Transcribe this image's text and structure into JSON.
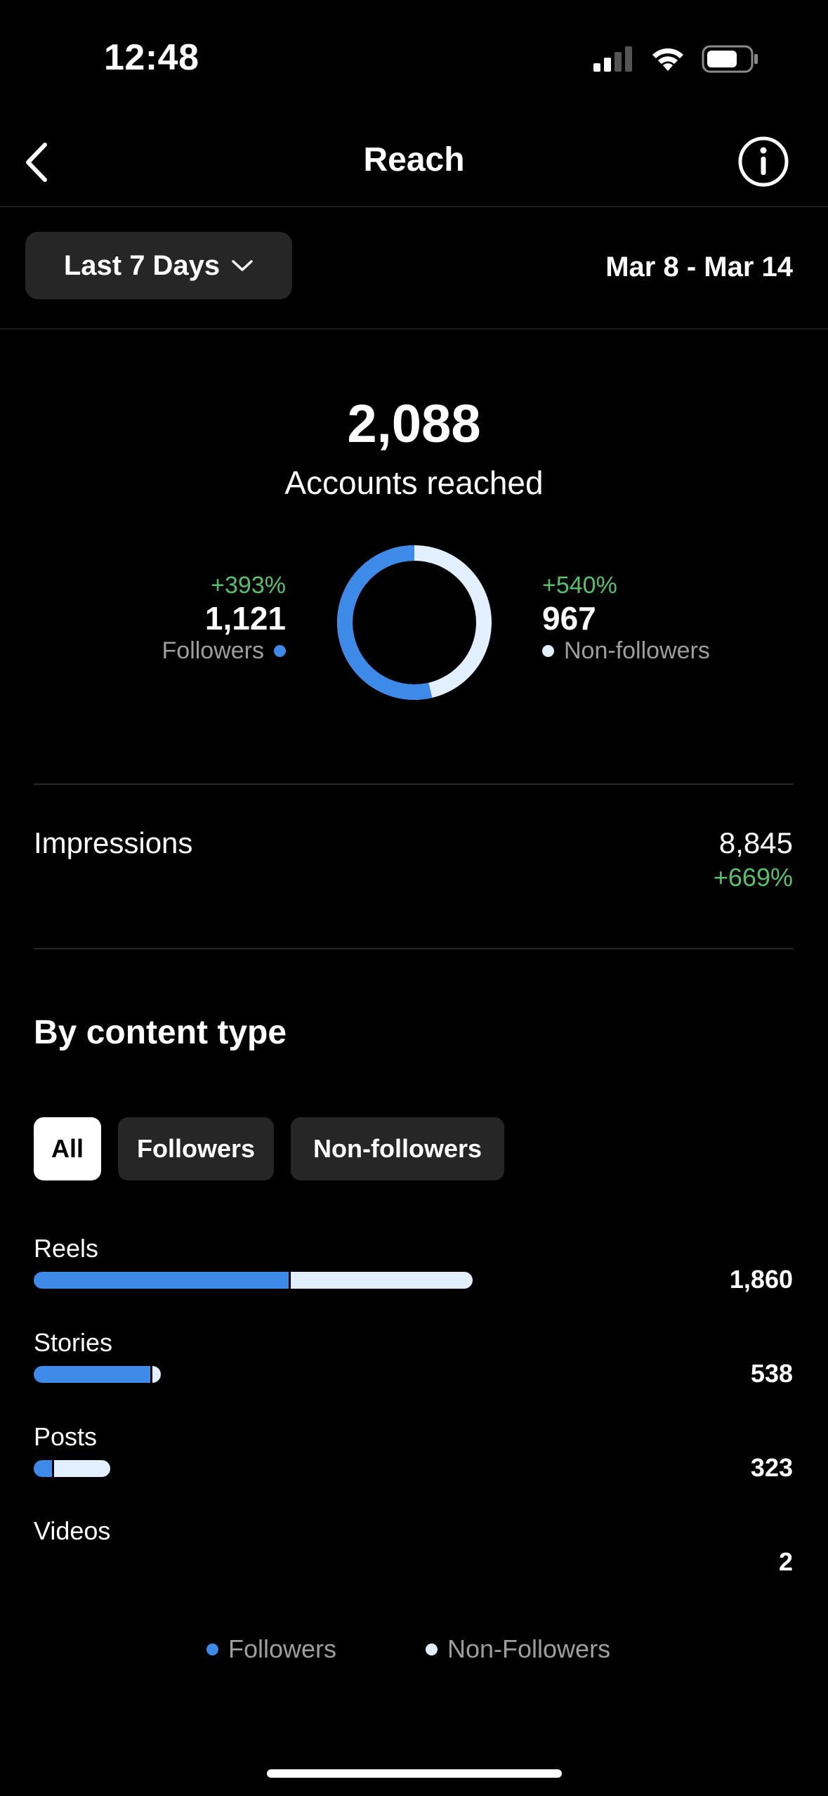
{
  "status_bar": {
    "time": "12:48"
  },
  "nav": {
    "title": "Reach"
  },
  "filter": {
    "range_label": "Last 7 Days",
    "date_range": "Mar 8 - Mar 14"
  },
  "summary": {
    "total": "2,088",
    "total_label": "Accounts reached",
    "followers": {
      "pct": "+393%",
      "value": "1,121",
      "label": "Followers",
      "share": 0.537
    },
    "non_followers": {
      "pct": "+540%",
      "value": "967",
      "label": "Non-followers",
      "share": 0.463
    }
  },
  "impressions": {
    "label": "Impressions",
    "value": "8,845",
    "pct": "+669%"
  },
  "content_type": {
    "title": "By content type",
    "tabs": [
      {
        "label": "All",
        "active": true
      },
      {
        "label": "Followers",
        "active": false
      },
      {
        "label": "Non-followers",
        "active": false
      }
    ],
    "rows": [
      {
        "label": "Reels",
        "value": "1,860",
        "total": 1860,
        "follower_fraction": 0.58
      },
      {
        "label": "Stories",
        "value": "538",
        "total": 538,
        "follower_fraction": 0.92
      },
      {
        "label": "Posts",
        "value": "323",
        "total": 323,
        "follower_fraction": 0.24
      },
      {
        "label": "Videos",
        "value": "2",
        "total": 2,
        "follower_fraction": 0.5
      }
    ],
    "legend": {
      "followers": "Followers",
      "non_followers": "Non-Followers"
    }
  },
  "colors": {
    "followers": "#3d8ae8",
    "non_followers": "#e2efff",
    "positive": "#58c06b"
  }
}
